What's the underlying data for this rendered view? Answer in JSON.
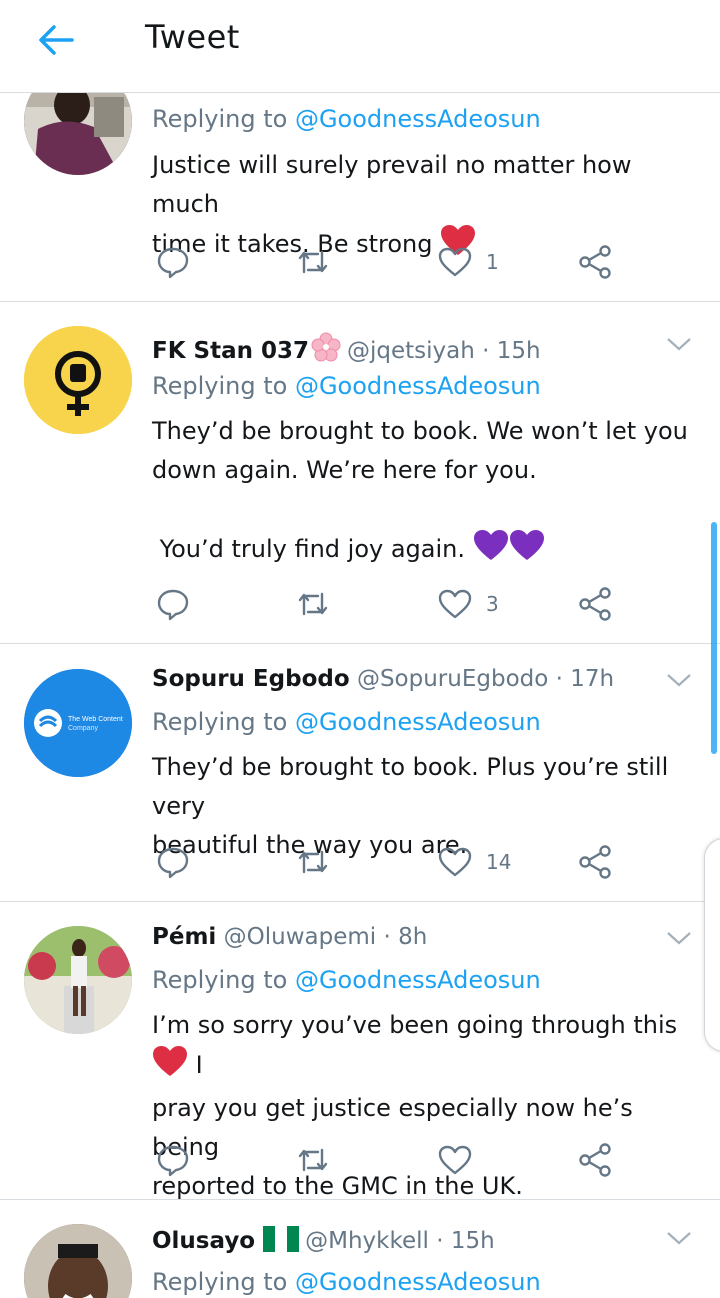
{
  "header": {
    "title": "Tweet"
  },
  "colors": {
    "accent": "#1da1f2",
    "secondary_text": "#657786",
    "heart_red": "#e0245e",
    "heart_purple": "#8a2be2"
  },
  "tweets": [
    {
      "name": "",
      "handle": "",
      "time": "",
      "replying_label": "Replying to ",
      "replying_to": "@GoodnessAdeosun",
      "lines": [
        "Justice will surely prevail no matter how much",
        "time it takes. Be strong"
      ],
      "emoji": "red-heart",
      "counts": {
        "reply": "",
        "retweet": "",
        "like": "1"
      }
    },
    {
      "name": "FK Stan 037",
      "name_emoji": "cherry-blossom",
      "handle": "@jqetsiyah",
      "time": "· 15h",
      "replying_label": "Replying to ",
      "replying_to": "@GoodnessAdeosun",
      "lines": [
        "They’d be brought to book. We won’t let you",
        "down again. We’re here for you.",
        "",
        " You’d truly find joy again."
      ],
      "emoji": "two-purple-hearts",
      "counts": {
        "reply": "",
        "retweet": "",
        "like": "3"
      }
    },
    {
      "name": "Sopuru Egbodo",
      "handle": "@SopuruEgbodo",
      "time": "· 17h",
      "replying_label": "Replying to ",
      "replying_to": "@GoodnessAdeosun",
      "avatar_text": [
        "The Web Content",
        "Company"
      ],
      "lines": [
        "They’d be brought to book. Plus you’re still very",
        "beautiful the way you are."
      ],
      "counts": {
        "reply": "",
        "retweet": "",
        "like": "14"
      }
    },
    {
      "name": "Pémi",
      "handle": "@Oluwapemi",
      "time": "· 8h",
      "replying_label": "Replying to ",
      "replying_to": "@GoodnessAdeosun",
      "line1_a": "I’m so sorry you’ve been going through this",
      "line1_b": " I",
      "lines_rest": [
        "pray you get justice especially now he’s being",
        "reported to the GMC in the UK."
      ],
      "counts": {
        "reply": "",
        "retweet": "",
        "like": ""
      }
    },
    {
      "name": "Olusayo",
      "name_emoji": "nigeria-flag",
      "handle": "@Mhykkell",
      "time": "· 15h",
      "replying_label": "Replying to ",
      "replying_to": "@GoodnessAdeosun"
    }
  ]
}
